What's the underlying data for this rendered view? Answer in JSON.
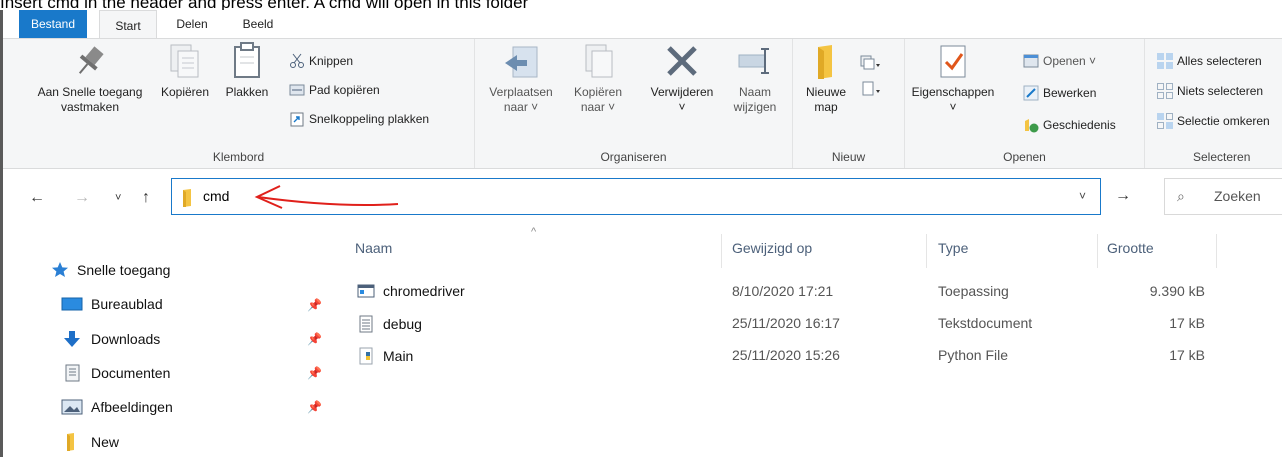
{
  "caption": "Insert cmd in the header and press enter. A cmd will open in this folder",
  "tabs": {
    "file": "Bestand",
    "start": "Start",
    "share": "Delen",
    "view": "Beeld"
  },
  "ribbon": {
    "clipboard": {
      "label": "Klembord",
      "pin": "Aan Snelle toegang\nvastmaken",
      "copy": "Kopiëren",
      "paste": "Plakken",
      "cut": "Knippen",
      "copy_path": "Pad kopiëren",
      "paste_shortcut": "Snelkoppeling plakken"
    },
    "organize": {
      "label": "Organiseren",
      "move_to": "Verplaatsen\nnaar ˅",
      "copy_to": "Kopiëren\nnaar ˅",
      "delete": "Verwijderen\n˅",
      "rename": "Naam\nwijzigen"
    },
    "new": {
      "label": "Nieuw",
      "new_folder": "Nieuwe\nmap"
    },
    "open": {
      "label": "Openen",
      "properties": "Eigenschappen\n˅",
      "open": "Openen ˅",
      "edit": "Bewerken",
      "history": "Geschiedenis"
    },
    "select": {
      "label": "Selecteren",
      "select_all": "Alles selecteren",
      "select_none": "Niets selecteren",
      "invert": "Selectie omkeren"
    }
  },
  "address_bar": {
    "path": "cmd",
    "search_placeholder": "Zoeken"
  },
  "nav_pane": {
    "quick_access": "Snelle toegang",
    "items": [
      {
        "label": "Bureaublad",
        "icon": "desktop-icon"
      },
      {
        "label": "Downloads",
        "icon": "download-icon"
      },
      {
        "label": "Documenten",
        "icon": "documents-icon"
      },
      {
        "label": "Afbeeldingen",
        "icon": "pictures-icon"
      },
      {
        "label": "New",
        "icon": "folder-icon"
      }
    ]
  },
  "file_list": {
    "columns": {
      "name": "Naam",
      "modified": "Gewijzigd op",
      "type": "Type",
      "size": "Grootte"
    },
    "rows": [
      {
        "name": "chromedriver",
        "modified": "8/10/2020 17:21",
        "type": "Toepassing",
        "size": "9.390 kB",
        "icon": "application-icon"
      },
      {
        "name": "debug",
        "modified": "25/11/2020 16:17",
        "type": "Tekstdocument",
        "size": "17 kB",
        "icon": "text-file-icon"
      },
      {
        "name": "Main",
        "modified": "25/11/2020 15:26",
        "type": "Python File",
        "size": "17 kB",
        "icon": "python-file-icon"
      }
    ]
  },
  "colors": {
    "accent": "#1979ca",
    "annotation_arrow": "#e0201b",
    "folder": "#f4c443"
  }
}
